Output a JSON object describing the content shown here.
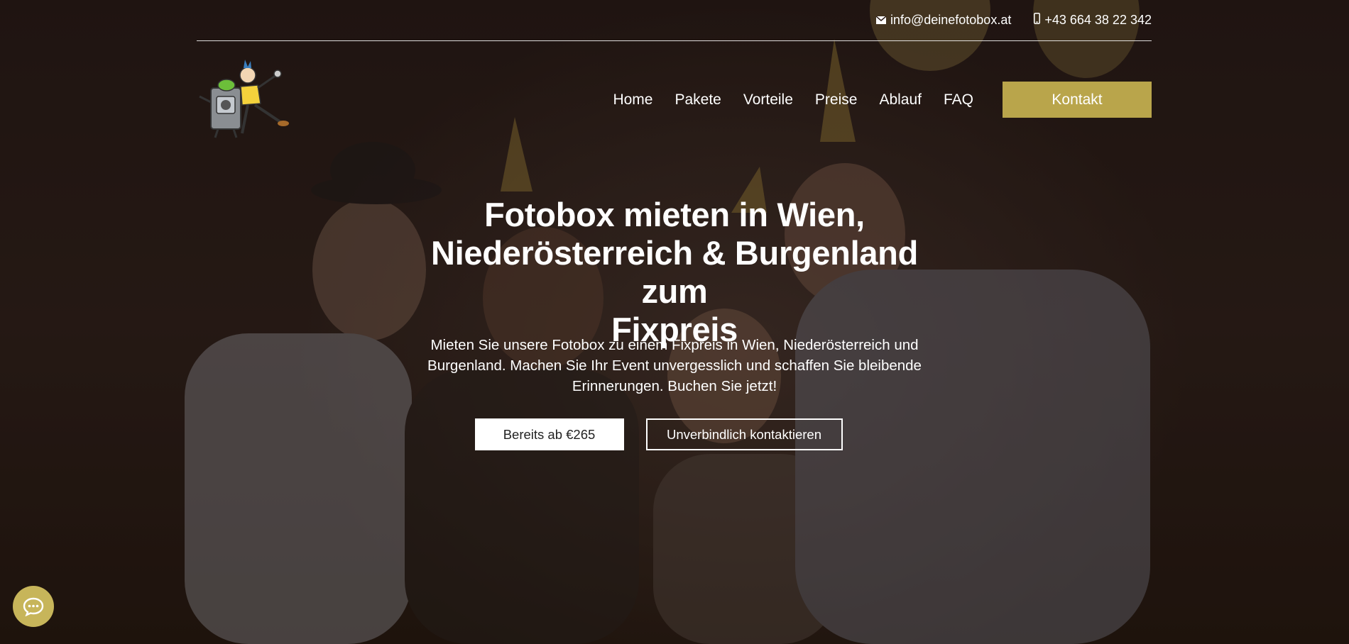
{
  "topbar": {
    "email_icon": "envelope-icon",
    "email": "info@deinefotobox.at",
    "phone_icon": "mobile-phone-icon",
    "phone": "+43 664 38 22 342"
  },
  "logo": {
    "icon": "fotobox-mascot-logo"
  },
  "nav": {
    "items": [
      "Home",
      "Pakete",
      "Vorteile",
      "Preise",
      "Ablauf",
      "FAQ"
    ],
    "contact_label": "Kontakt"
  },
  "hero": {
    "title_line1": "Fotobox mieten in Wien,",
    "title_line2": "Niederösterreich & Burgenland zum",
    "title_line3": "Fixpreis",
    "subtitle_line1": "Mieten Sie unsere Fotobox zu einem Fixpreis in Wien, Niederösterreich und",
    "subtitle_line2": "Burgenland. Machen Sie Ihr Event unvergesslich und schaffen Sie bleibende",
    "subtitle_line3": "Erinnerungen. Buchen Sie jetzt!",
    "cta_primary": "Bereits ab €265",
    "cta_secondary": "Unverbindlich kontaktieren"
  },
  "chat": {
    "icon": "chat-bubble-icon"
  },
  "colors": {
    "accent": "#b9a54b",
    "chat_bg": "#c7b55a",
    "background": "#2a1c18"
  }
}
